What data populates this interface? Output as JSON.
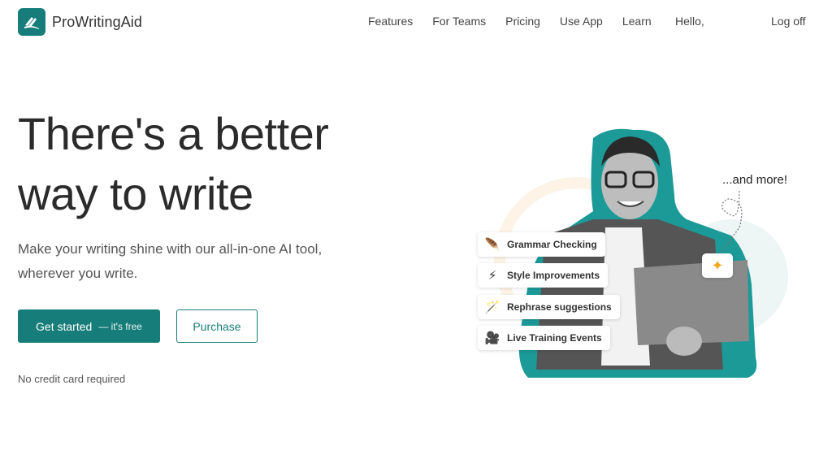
{
  "nav": {
    "brand": "ProWritingAid",
    "links": [
      "Features",
      "For Teams",
      "Pricing",
      "Use App",
      "Learn"
    ],
    "greeting": "Hello,",
    "logoff": "Log off"
  },
  "hero": {
    "title_line1": "There's a better",
    "title_line2": "way to write",
    "subtitle_line1": "Make your writing shine with our all-in-one AI tool,",
    "subtitle_line2": "wherever you write.",
    "primary_cta": "Get started",
    "primary_cta_note": "— it's free",
    "secondary_cta": "Purchase",
    "note": "No credit card required"
  },
  "illustration": {
    "features": [
      {
        "icon": "quill-icon",
        "glyph": "🪶",
        "label": "Grammar Checking"
      },
      {
        "icon": "lightning-icon",
        "glyph": "⚡",
        "label": "Style Improvements"
      },
      {
        "icon": "magic-wand-icon",
        "glyph": "🪄",
        "label": "Rephrase suggestions"
      },
      {
        "icon": "video-camera-icon",
        "glyph": "🎥",
        "label": "Live Training Events"
      }
    ],
    "and_more": "...and more!",
    "sparkle_glyph": "✦"
  },
  "colors": {
    "brand": "#177d7a",
    "accent": "#f2a71b"
  }
}
